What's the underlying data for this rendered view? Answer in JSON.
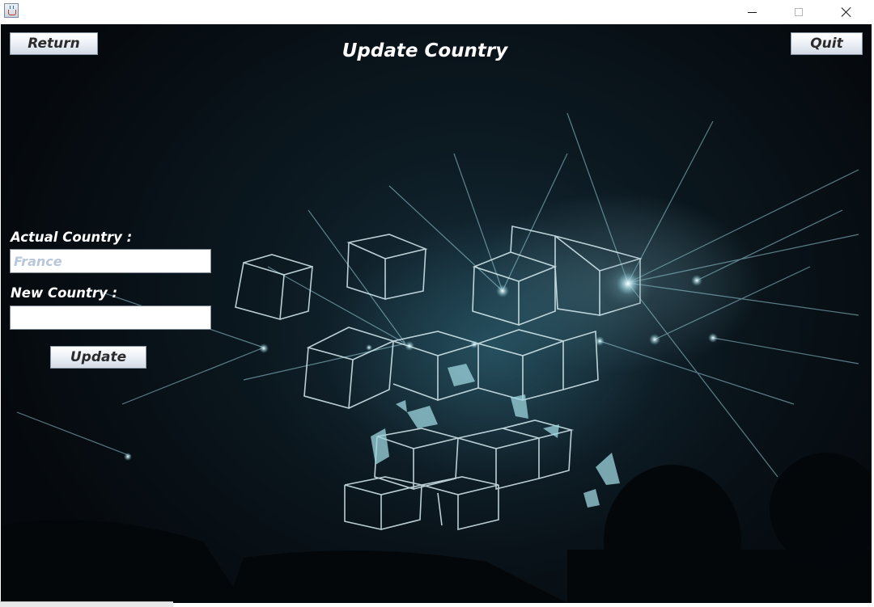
{
  "window": {
    "icon": "java-cup-icon",
    "controls": [
      "minimize-icon",
      "maximize-icon",
      "close-icon"
    ]
  },
  "header": {
    "title": "Update Country",
    "return_label": "Return",
    "quit_label": "Quit"
  },
  "form": {
    "actual_label": "Actual Country :",
    "actual_value": "France",
    "new_label": "New Country :",
    "new_value": "",
    "update_label": "Update"
  },
  "colors": {
    "title_text": "#ffffff",
    "placeholder_text": "#b8c8da",
    "background_dark": "#0a151c",
    "accent_cyan": "#8fd3e0"
  }
}
